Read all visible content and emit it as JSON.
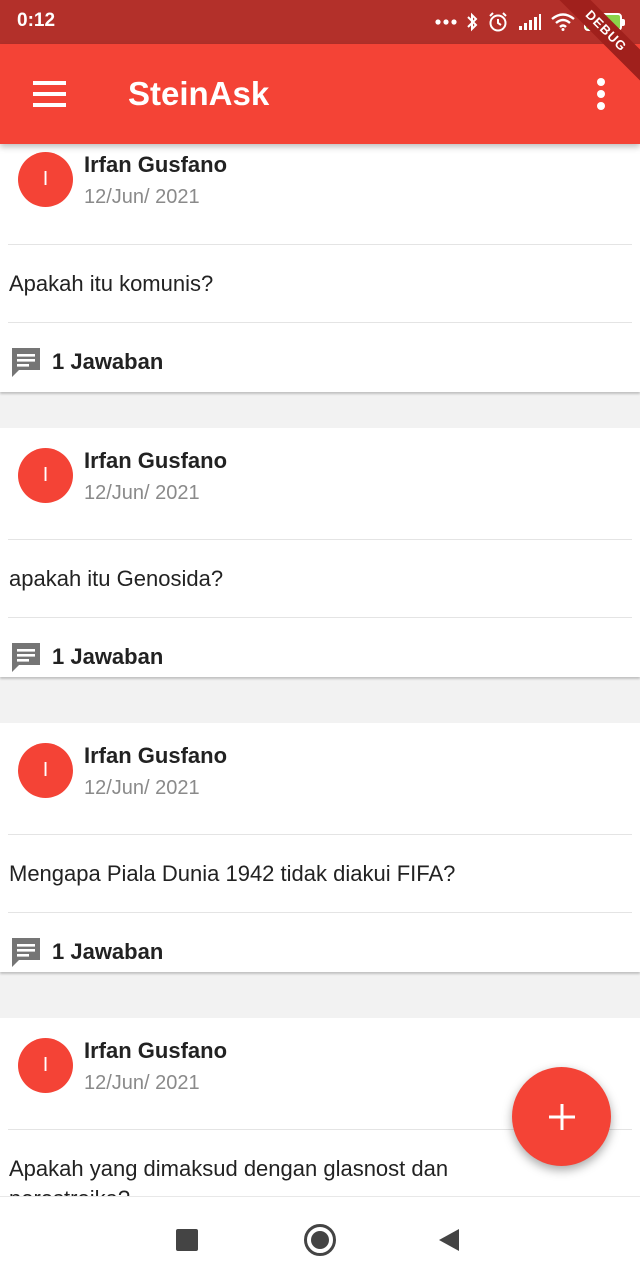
{
  "status_bar": {
    "time": "0:12",
    "battery": "84",
    "icons": [
      "more-dots-icon",
      "bluetooth-icon",
      "alarm-icon",
      "signal-icon",
      "wifi-icon",
      "battery-icon"
    ]
  },
  "debug_banner": "DEBUG",
  "app_bar": {
    "title": "SteinAsk",
    "menu_icon": "menu-icon",
    "more_icon": "more-vertical-icon"
  },
  "posts": [
    {
      "avatar_letter": "I",
      "author": "Irfan Gusfano",
      "date": "12/Jun/ 2021",
      "question": "Apakah itu komunis?",
      "answers_label": "1 Jawaban"
    },
    {
      "avatar_letter": "I",
      "author": "Irfan Gusfano",
      "date": "12/Jun/ 2021",
      "question": "apakah itu Genosida?",
      "answers_label": "1 Jawaban"
    },
    {
      "avatar_letter": "I",
      "author": "Irfan Gusfano",
      "date": "12/Jun/ 2021",
      "question": "Mengapa Piala Dunia 1942 tidak diakui FIFA?",
      "answers_label": "1 Jawaban"
    },
    {
      "avatar_letter": "I",
      "author": "Irfan Gusfano",
      "date": "12/Jun/ 2021",
      "question": "Apakah yang dimaksud dengan glasnost dan perestroika?"
    }
  ],
  "fab": {
    "icon": "add-icon",
    "label": "+"
  },
  "nav_bar": {
    "icons": [
      "recent-apps-icon",
      "home-icon",
      "back-icon"
    ]
  },
  "colors": {
    "primary": "#f44336",
    "status_bar": "#b3302a",
    "background": "#f2f2f2",
    "secondary_text": "#8a8a8a"
  }
}
